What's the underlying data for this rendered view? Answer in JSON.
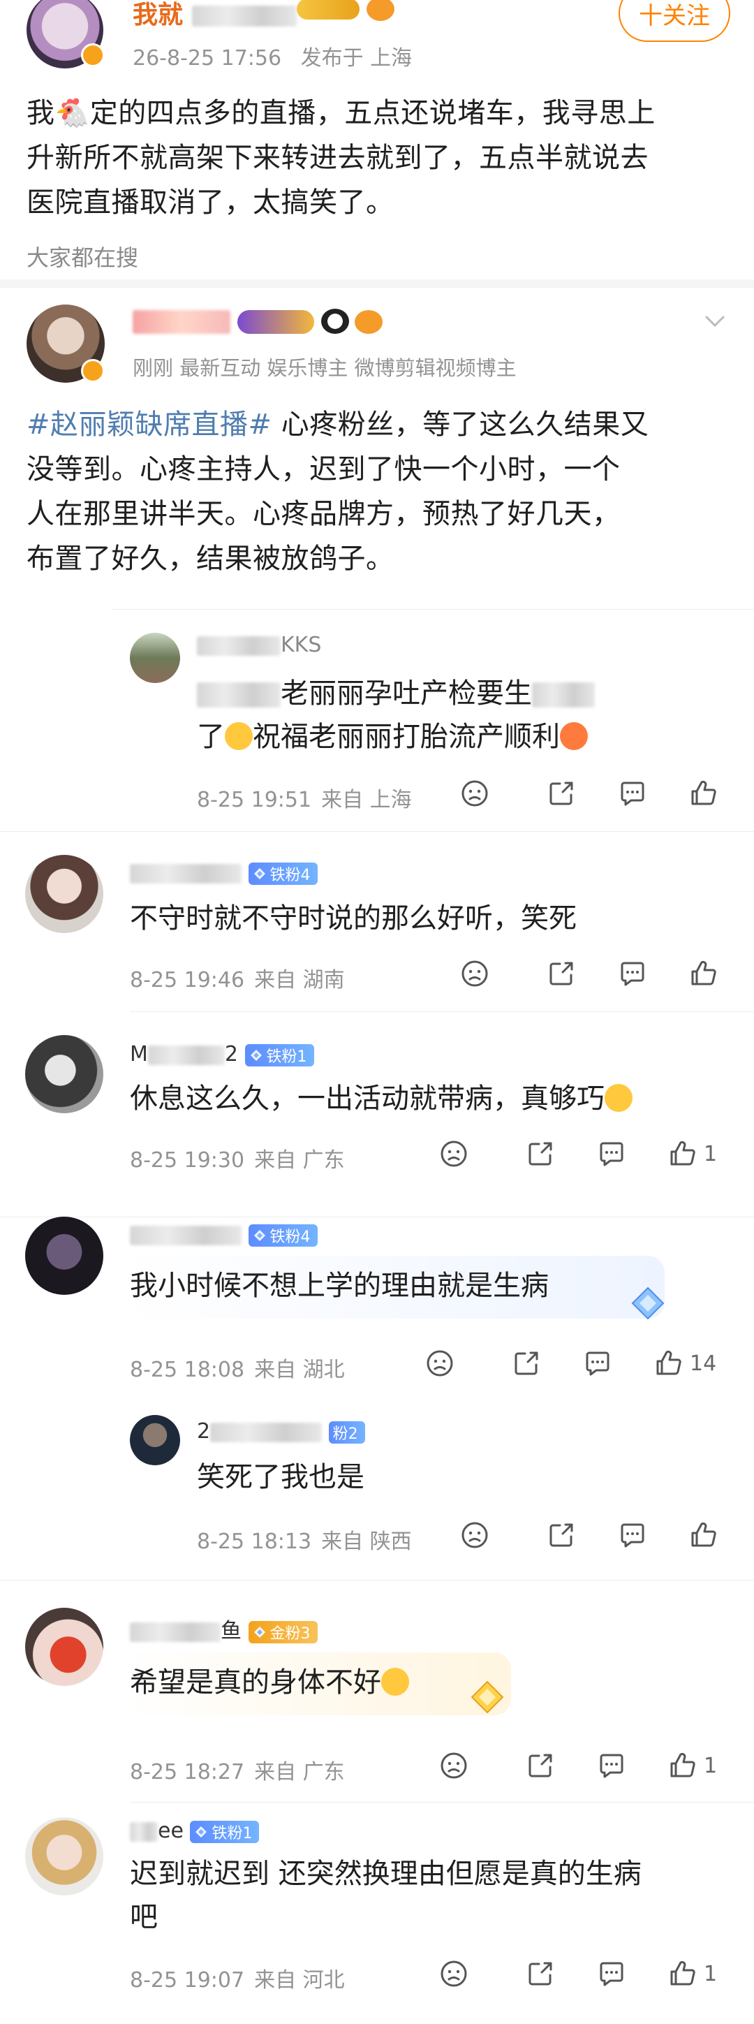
{
  "post": {
    "author_name": "我就",
    "timestamp": "26-8-25 17:56",
    "location": "发布于 上海",
    "follow_label": "十关注",
    "text_line1": "我🐔定的四点多的直播，五点还说堵车，我寻思上",
    "text_line2": "升新所不就高架下来转进去就到了，五点半就说去",
    "text_line3": "医院直播取消了，太搞笑了。"
  },
  "search_hint": "大家都在搜",
  "post2": {
    "meta": "刚刚  最新互动   娱乐博主  微博剪辑视频博主",
    "topic": "#赵丽颖缺席直播#",
    "line1_rest": " 心疼粉丝，等了这么久结果又",
    "line2": "没等到。心疼主持人，迟到了快一个小时，一个",
    "line3": "人在那里讲半天。心疼品牌方，预热了好几天，",
    "line4": "布置了好久，结果被放鸽子。"
  },
  "comments": [
    {
      "name_suffix": "KKS",
      "line1": "老丽丽孕吐产检要生",
      "line2a": "了",
      "line2b": "祝福老丽丽打胎流产顺利",
      "time": "8-25 19:51",
      "location": "来自 上海",
      "likes": ""
    },
    {
      "badge": "铁粉4",
      "text": "不守时就不守时说的那么好听，笑死",
      "time": "8-25 19:46",
      "location": "来自 湖南",
      "likes": ""
    },
    {
      "name_prefix": "M",
      "name_suffix": "2",
      "badge": "铁粉1",
      "text": "休息这么久，一出活动就带病，真够巧",
      "time": "8-25 19:30",
      "location": "来自 广东",
      "likes": "1"
    },
    {
      "badge": "铁粉4",
      "text": "我小时候不想上学的理由就是生病",
      "time": "8-25 18:08",
      "location": "来自 湖北",
      "likes": "14"
    },
    {
      "name_prefix": "2",
      "badge": "粉2",
      "text": "笑死了我也是",
      "time": "8-25 18:13",
      "location": "来自 陕西",
      "likes": ""
    },
    {
      "name_suffix": "鱼",
      "badge": "金粉3",
      "text": "希望是真的身体不好",
      "time": "8-25 18:27",
      "location": "来自 广东",
      "likes": "1"
    },
    {
      "name_suffix": "ee",
      "badge": "铁粉1",
      "line1": "迟到就迟到 还突然换理由但愿是真的生病",
      "line2": "吧",
      "time": "8-25 19:07",
      "location": "来自 河北",
      "likes": "1"
    }
  ],
  "colors": {
    "accent": "#ff8200",
    "topic": "#507daf",
    "meta": "#939393"
  }
}
